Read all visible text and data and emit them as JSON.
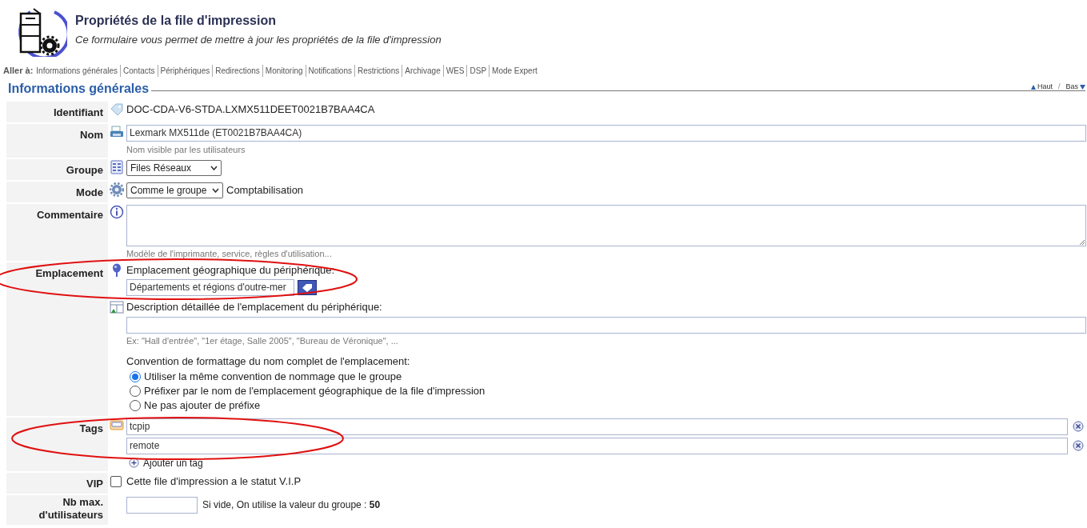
{
  "header": {
    "title": "Propriétés de la file d'impression",
    "subtitle": "Ce formulaire vous permet de mettre à jour les propriétés de la file d'impression"
  },
  "nav": {
    "label": "Aller à:",
    "links": [
      "Informations générales",
      "Contacts",
      "Périphériques",
      "Redirections",
      "Monitoring",
      "Notifications",
      "Restrictions",
      "Archivage",
      "WES",
      "DSP",
      "Mode Expert"
    ]
  },
  "section": {
    "title": "Informations générales",
    "top_link": "Haut",
    "separator": "/",
    "bottom_link": "Bas"
  },
  "rows": [
    {
      "kind": "text",
      "label": "Identifiant",
      "value": "DOC-CDA-V6-STDA.LXMX511DEET0021B7BAA4CA"
    },
    {
      "kind": "input",
      "label": "Nom",
      "value": "Lexmark MX511de (ET0021B7BAA4CA)",
      "hint": "Nom visible par les utilisateurs"
    },
    {
      "kind": "select",
      "label": "Groupe",
      "value": "Files Réseaux"
    },
    {
      "kind": "select",
      "label": "Mode",
      "value": "Comme le groupe",
      "after": "Comptabilisation"
    },
    {
      "kind": "textarea",
      "label": "Commentaire",
      "hint": "Modèle de l'imprimante, service, règles d'utilisation..."
    },
    {
      "kind": "location",
      "label": "Emplacement",
      "geo_label": "Emplacement géographique du périphérique:",
      "geo_value": "Départements et régions d'outre-mer",
      "desc_label": "Description détaillée de l'emplacement du périphérique:",
      "desc_hint": "Ex: \"Hall d'entrée\", \"1er étage, Salle 2005\", \"Bureau de Véronique\", ...",
      "convention_label": "Convention de formattage du nom complet de l'emplacement:",
      "options": [
        {
          "label": "Utiliser la même convention de nommage que le groupe",
          "selected": true
        },
        {
          "label": "Préfixer par le nom de l'emplacement géographique de la file d'impression",
          "selected": false
        },
        {
          "label": "Ne pas ajouter de préfixe",
          "selected": false
        }
      ]
    },
    {
      "kind": "tags",
      "label": "Tags",
      "tags": [
        "tcpip",
        "remote"
      ],
      "add": "Ajouter un tag"
    },
    {
      "kind": "checkbox",
      "label": "VIP",
      "checked": false,
      "text": "Cette file d'impression a le statut V.I.P"
    },
    {
      "kind": "number",
      "label": "Nb max. d'utilisateurs",
      "note": "Si vide, On utilise la valeur du groupe : **50**"
    }
  ]
}
